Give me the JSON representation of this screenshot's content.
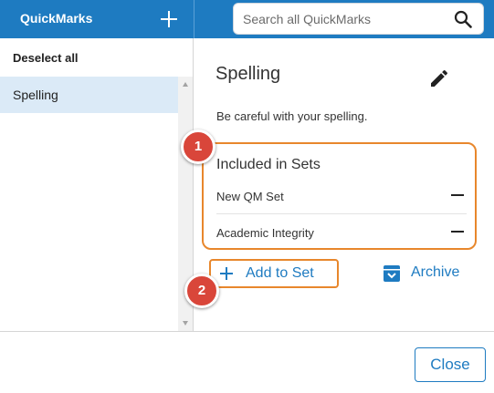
{
  "header": {
    "app_title": "QuickMarks",
    "add_icon": "plus-icon",
    "search_placeholder": "Search all QuickMarks",
    "search_value": "",
    "search_icon": "search-icon",
    "bar_color": "#1e7bc1"
  },
  "sidebar": {
    "deselect_label": "Deselect all",
    "items": [
      {
        "label": "Spelling",
        "selected": true
      }
    ]
  },
  "detail": {
    "title": "Spelling",
    "edit_icon": "pencil-icon",
    "description": "Be careful with your spelling.",
    "sets_heading": "Included in Sets",
    "sets": [
      {
        "name": "New QM Set",
        "remove_icon": "minus-icon"
      },
      {
        "name": "Academic Integrity",
        "remove_icon": "minus-icon"
      }
    ],
    "add_to_set_label": "Add to Set",
    "archive_label": "Archive",
    "archive_icon": "archive-box-icon"
  },
  "annotations": [
    {
      "number": "1",
      "color": "#d9463a"
    },
    {
      "number": "2",
      "color": "#d9463a"
    }
  ],
  "highlight_color": "#e8872c",
  "footer": {
    "close_label": "Close"
  }
}
